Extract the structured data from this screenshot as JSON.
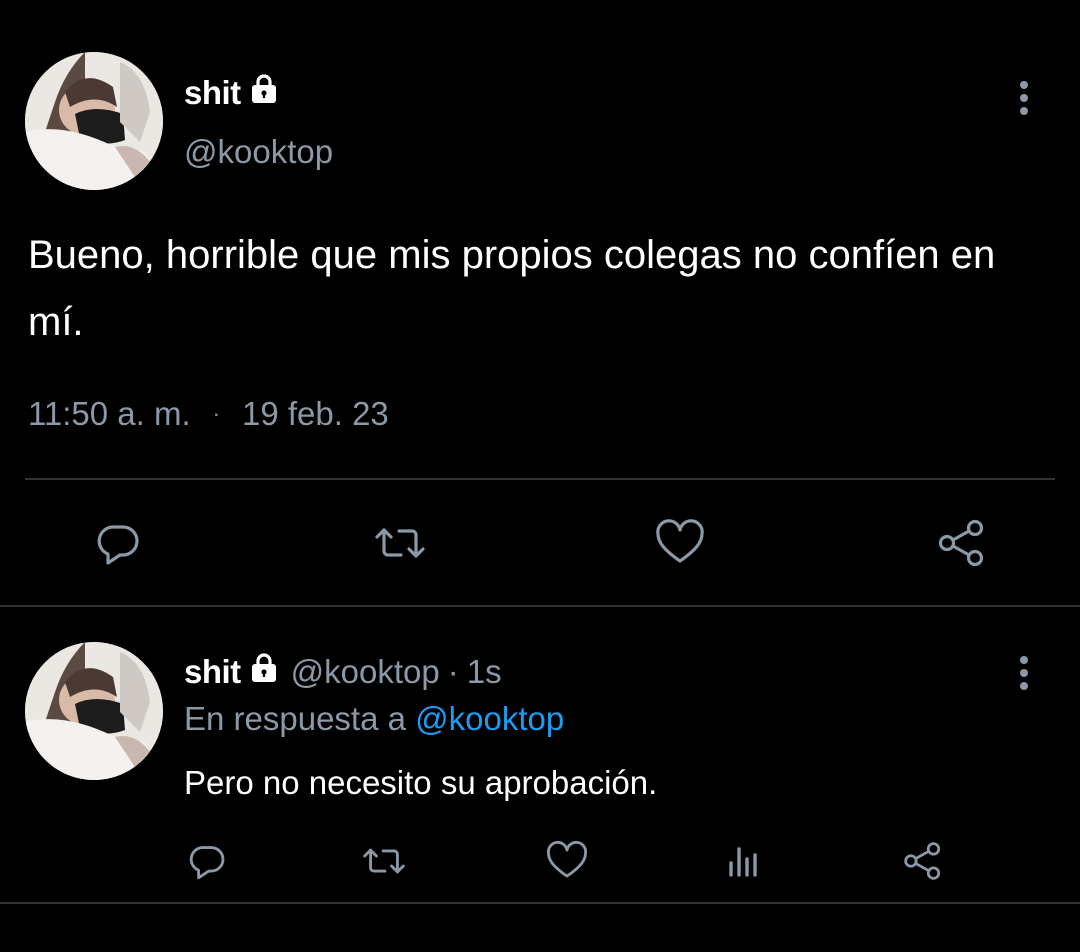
{
  "main_tweet": {
    "display_name": "shit",
    "handle": "@kooktop",
    "text": "Bueno, horrible que mis propios colegas no confíen en mí.",
    "time": "11:50 a. m.",
    "separator": "·",
    "date": "19 feb. 23",
    "actions": [
      "reply-icon",
      "retweet-icon",
      "like-icon",
      "share-icon"
    ]
  },
  "reply_tweet": {
    "display_name": "shit",
    "handle": "@kooktop",
    "separator": "·",
    "time": "1s",
    "in_reply_to_prefix": "En respuesta a",
    "in_reply_to_handle": "@kooktop",
    "text": "Pero no necesito su aprobación.",
    "actions": [
      "reply-icon",
      "retweet-icon",
      "like-icon",
      "analytics-icon",
      "share-icon"
    ]
  },
  "colors": {
    "background": "#000000",
    "primary_text": "#ffffff",
    "secondary_text": "#8b98a5",
    "mention": "#1d9bf0",
    "divider": "#2f3336",
    "icon": "#8b98a5"
  }
}
